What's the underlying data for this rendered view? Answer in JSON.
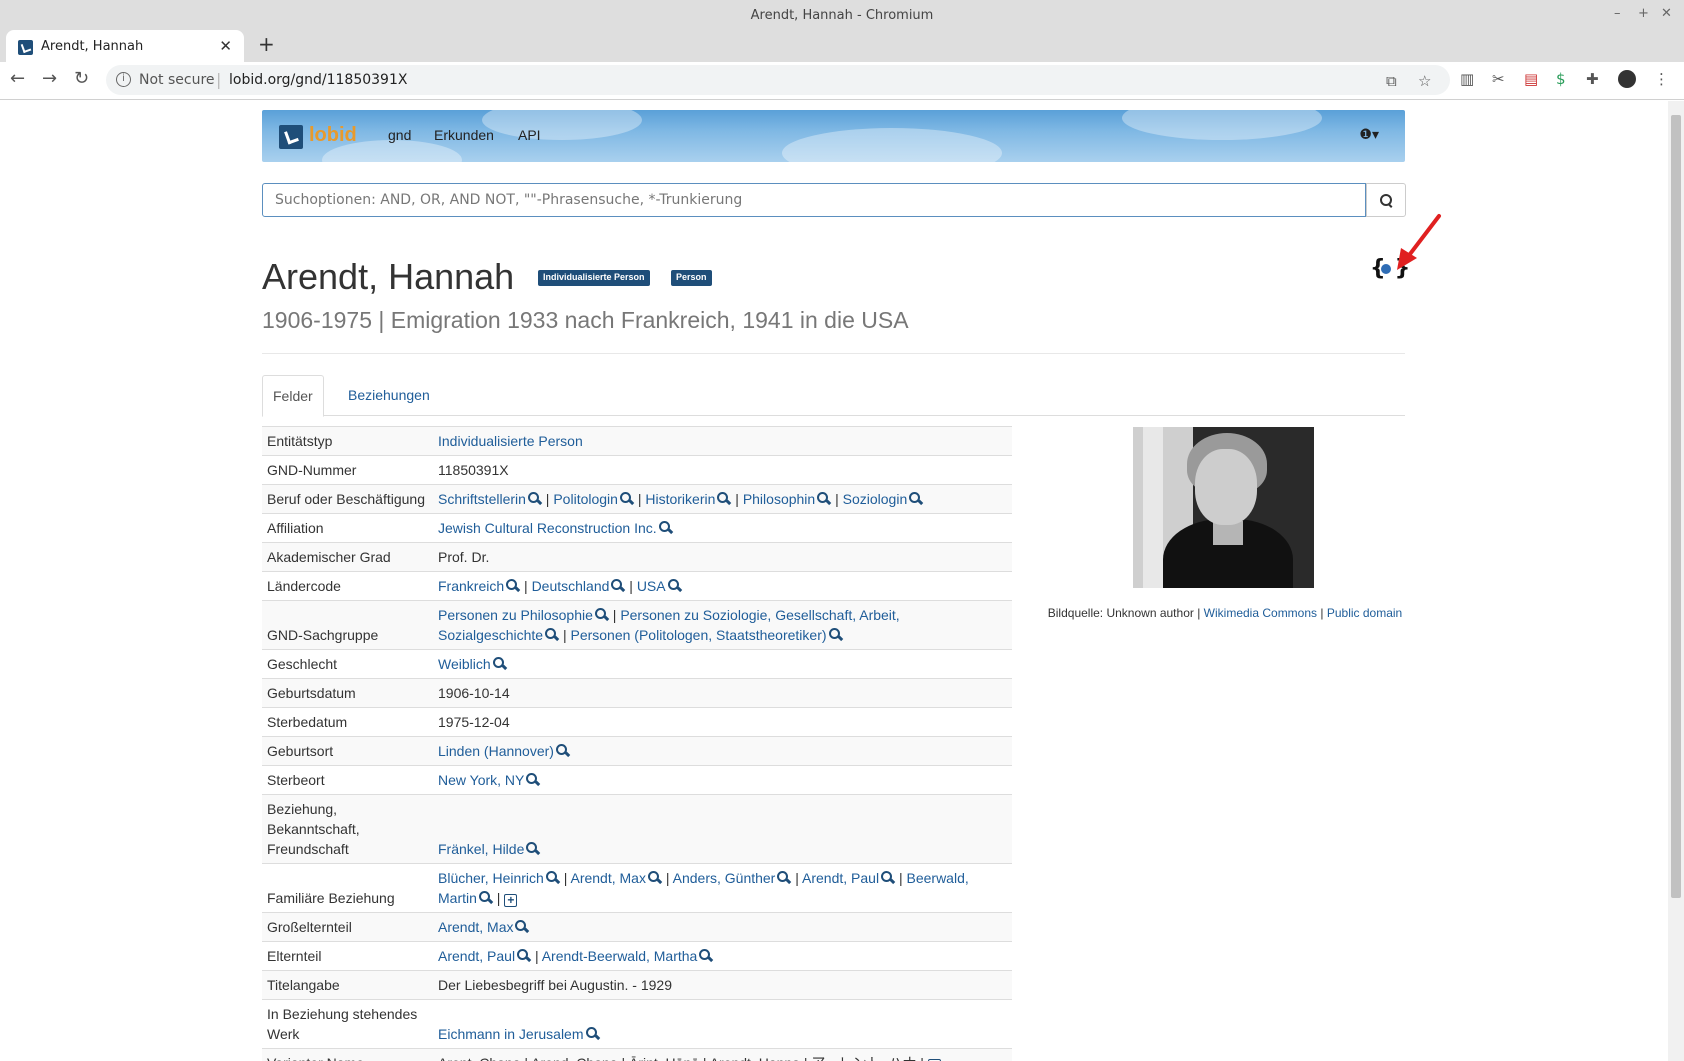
{
  "window": {
    "title": "Arendt, Hannah - Chromium",
    "controls": [
      "–",
      "+",
      "✕"
    ]
  },
  "browser": {
    "tab_title": "Arendt, Hannah",
    "tab_close": "✕",
    "new_tab": "+",
    "security_label": "Not secure",
    "separator": "|",
    "url": "lobid.org/gnd/11850391X",
    "back": "←",
    "forward": "→",
    "reload": "↻",
    "translate_icon": "⧉",
    "star_icon": "☆",
    "menu_icon": "⋮"
  },
  "site": {
    "logo": "lobid",
    "nav": [
      "gnd",
      "Erkunden",
      "API"
    ],
    "info_icon": "❶▾"
  },
  "search": {
    "placeholder": "Suchoptionen: AND, OR, AND NOT, \"\"-Phrasensuche, *-Trunkierung",
    "value": ""
  },
  "entity": {
    "name": "Arendt, Hannah",
    "badges": [
      "Individualisierte Person",
      "Person"
    ],
    "subtitle": "1906-1975 | Emigration 1933 nach Frankreich, 1941 in die USA",
    "jsonld_icon": "{}"
  },
  "tabs": [
    "Felder",
    "Beziehungen"
  ],
  "fields": [
    {
      "key": "Entitätstyp",
      "values": [
        {
          "text": "Individualisierte Person",
          "link": true,
          "search": false
        }
      ]
    },
    {
      "key": "GND-Nummer",
      "values": [
        {
          "text": "11850391X",
          "link": false,
          "search": false
        }
      ]
    },
    {
      "key": "Beruf oder Beschäftigung",
      "values": [
        {
          "text": "Schriftstellerin",
          "link": true,
          "search": true
        },
        {
          "text": "Politologin",
          "link": true,
          "search": true
        },
        {
          "text": "Historikerin",
          "link": true,
          "search": true
        },
        {
          "text": "Philosophin",
          "link": true,
          "search": true
        },
        {
          "text": "Soziologin",
          "link": true,
          "search": true
        }
      ]
    },
    {
      "key": "Affiliation",
      "values": [
        {
          "text": "Jewish Cultural Reconstruction Inc.",
          "link": true,
          "search": true
        }
      ]
    },
    {
      "key": "Akademischer Grad",
      "values": [
        {
          "text": "Prof. Dr.",
          "link": false,
          "search": false
        }
      ]
    },
    {
      "key": "Ländercode",
      "values": [
        {
          "text": "Frankreich",
          "link": true,
          "search": true
        },
        {
          "text": "Deutschland",
          "link": true,
          "search": true
        },
        {
          "text": "USA",
          "link": true,
          "search": true
        }
      ]
    },
    {
      "key": "GND-Sachgruppe",
      "values": [
        {
          "text": "Personen zu Philosophie",
          "link": true,
          "search": true
        },
        {
          "text": "Personen zu Soziologie, Gesellschaft, Arbeit, Sozialgeschichte",
          "link": true,
          "search": true
        },
        {
          "text": "Personen (Politologen, Staatstheoretiker)",
          "link": true,
          "search": true
        }
      ]
    },
    {
      "key": "Geschlecht",
      "values": [
        {
          "text": "Weiblich",
          "link": true,
          "search": true
        }
      ]
    },
    {
      "key": "Geburtsdatum",
      "values": [
        {
          "text": "1906-10-14",
          "link": false,
          "search": false
        }
      ]
    },
    {
      "key": "Sterbedatum",
      "values": [
        {
          "text": "1975-12-04",
          "link": false,
          "search": false
        }
      ]
    },
    {
      "key": "Geburtsort",
      "values": [
        {
          "text": "Linden (Hannover)",
          "link": true,
          "search": true
        }
      ]
    },
    {
      "key": "Sterbeort",
      "values": [
        {
          "text": "New York, NY",
          "link": true,
          "search": true
        }
      ]
    },
    {
      "key": "Beziehung, Bekanntschaft, Freundschaft",
      "values": [
        {
          "text": "Fränkel, Hilde",
          "link": true,
          "search": true
        }
      ]
    },
    {
      "key": "Familiäre Beziehung",
      "more": true,
      "values": [
        {
          "text": "Blücher, Heinrich",
          "link": true,
          "search": true
        },
        {
          "text": "Arendt, Max",
          "link": true,
          "search": true
        },
        {
          "text": "Anders, Günther",
          "link": true,
          "search": true
        },
        {
          "text": "Arendt, Paul",
          "link": true,
          "search": true
        },
        {
          "text": "Beerwald, Martin",
          "link": true,
          "search": true
        }
      ]
    },
    {
      "key": "Großelternteil",
      "values": [
        {
          "text": "Arendt, Max",
          "link": true,
          "search": true
        }
      ]
    },
    {
      "key": "Elternteil",
      "values": [
        {
          "text": "Arendt, Paul",
          "link": true,
          "search": true
        },
        {
          "text": "Arendt-Beerwald, Martha",
          "link": true,
          "search": true
        }
      ]
    },
    {
      "key": "Titelangabe",
      "values": [
        {
          "text": "Der Liebesbegriff bei Augustin. - 1929",
          "link": false,
          "search": false
        }
      ]
    },
    {
      "key": "In Beziehung stehendes Werk",
      "values": [
        {
          "text": "Eichmann in Jerusalem",
          "link": true,
          "search": true
        }
      ]
    },
    {
      "key": "Varianter Name",
      "more": true,
      "values": [
        {
          "text": "Arent, Chana",
          "link": false,
          "search": false
        },
        {
          "text": "Arend, Chana",
          "link": false,
          "search": false
        },
        {
          "text": "Ārint, Hānā",
          "link": false,
          "search": false
        },
        {
          "text": "Arendt, Hanna",
          "link": false,
          "search": false
        },
        {
          "text": "アーレント, ハナ",
          "link": false,
          "search": false
        }
      ]
    }
  ],
  "image": {
    "caption_prefix": "Bildquelle: Unknown author",
    "sep": "|",
    "source_link": "Wikimedia Commons",
    "license_link": "Public domain"
  },
  "colors": {
    "link": "#1f5d99",
    "badge": "#1f4e79",
    "logo_text": "#e89a2c",
    "annotation_arrow": "#e02020"
  }
}
